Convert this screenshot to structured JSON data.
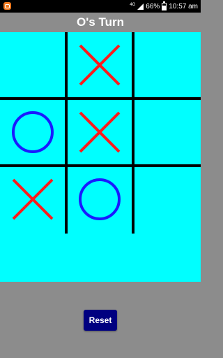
{
  "status_bar": {
    "network": "4G",
    "battery": "66%",
    "time": "10:57 am"
  },
  "header": {
    "title": "O's Turn"
  },
  "board": {
    "cells": [
      [
        "",
        "X",
        ""
      ],
      [
        "O",
        "X",
        ""
      ],
      [
        "X",
        "O",
        ""
      ]
    ]
  },
  "controls": {
    "reset_label": "Reset"
  },
  "colors": {
    "board_bg": "#00ffff",
    "x_mark": "#ff1a1a",
    "o_mark": "#1a1aff",
    "grid": "#000000",
    "reset_button": "#000080",
    "header_bg": "#8c8c8c"
  }
}
